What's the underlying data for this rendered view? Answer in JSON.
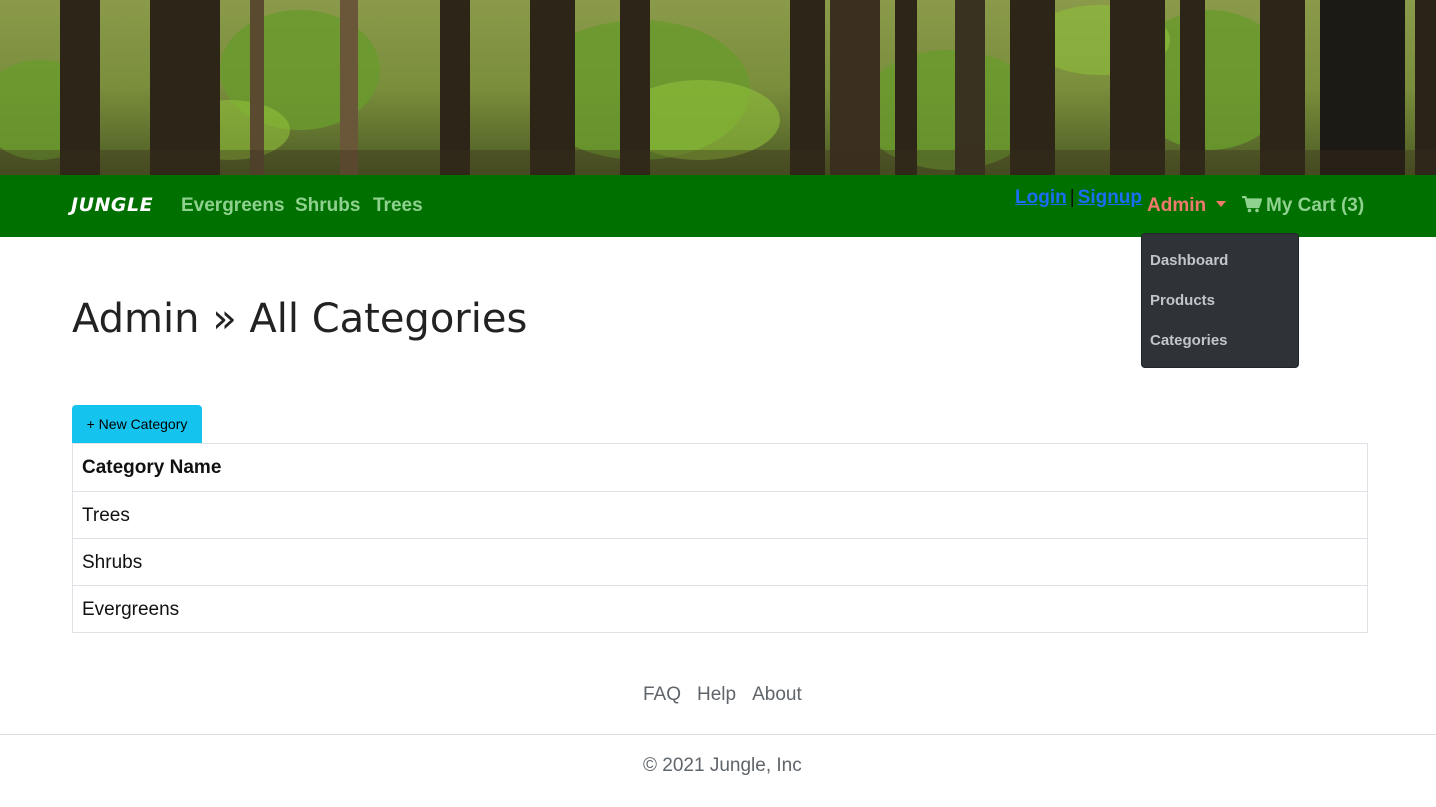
{
  "hero": {
    "description": "forest banner",
    "icon": "forest-image"
  },
  "navbar": {
    "brand": "JUNGLE",
    "links": [
      "Evergreens",
      "Shrubs",
      "Trees"
    ],
    "login": "Login",
    "separator": "|",
    "signup": "Signup",
    "admin": "Admin",
    "cart": "My Cart (3)",
    "color": "#007000"
  },
  "dropdown": {
    "items": [
      "Dashboard",
      "Products",
      "Categories"
    ]
  },
  "main": {
    "title": "Admin » All Categories",
    "new_button": "+ New Category",
    "table": {
      "header": "Category Name",
      "rows": [
        "Trees",
        "Shrubs",
        "Evergreens"
      ]
    }
  },
  "footer": {
    "links": [
      "FAQ",
      "Help",
      "About"
    ],
    "copyright": "© 2021 Jungle, Inc"
  }
}
